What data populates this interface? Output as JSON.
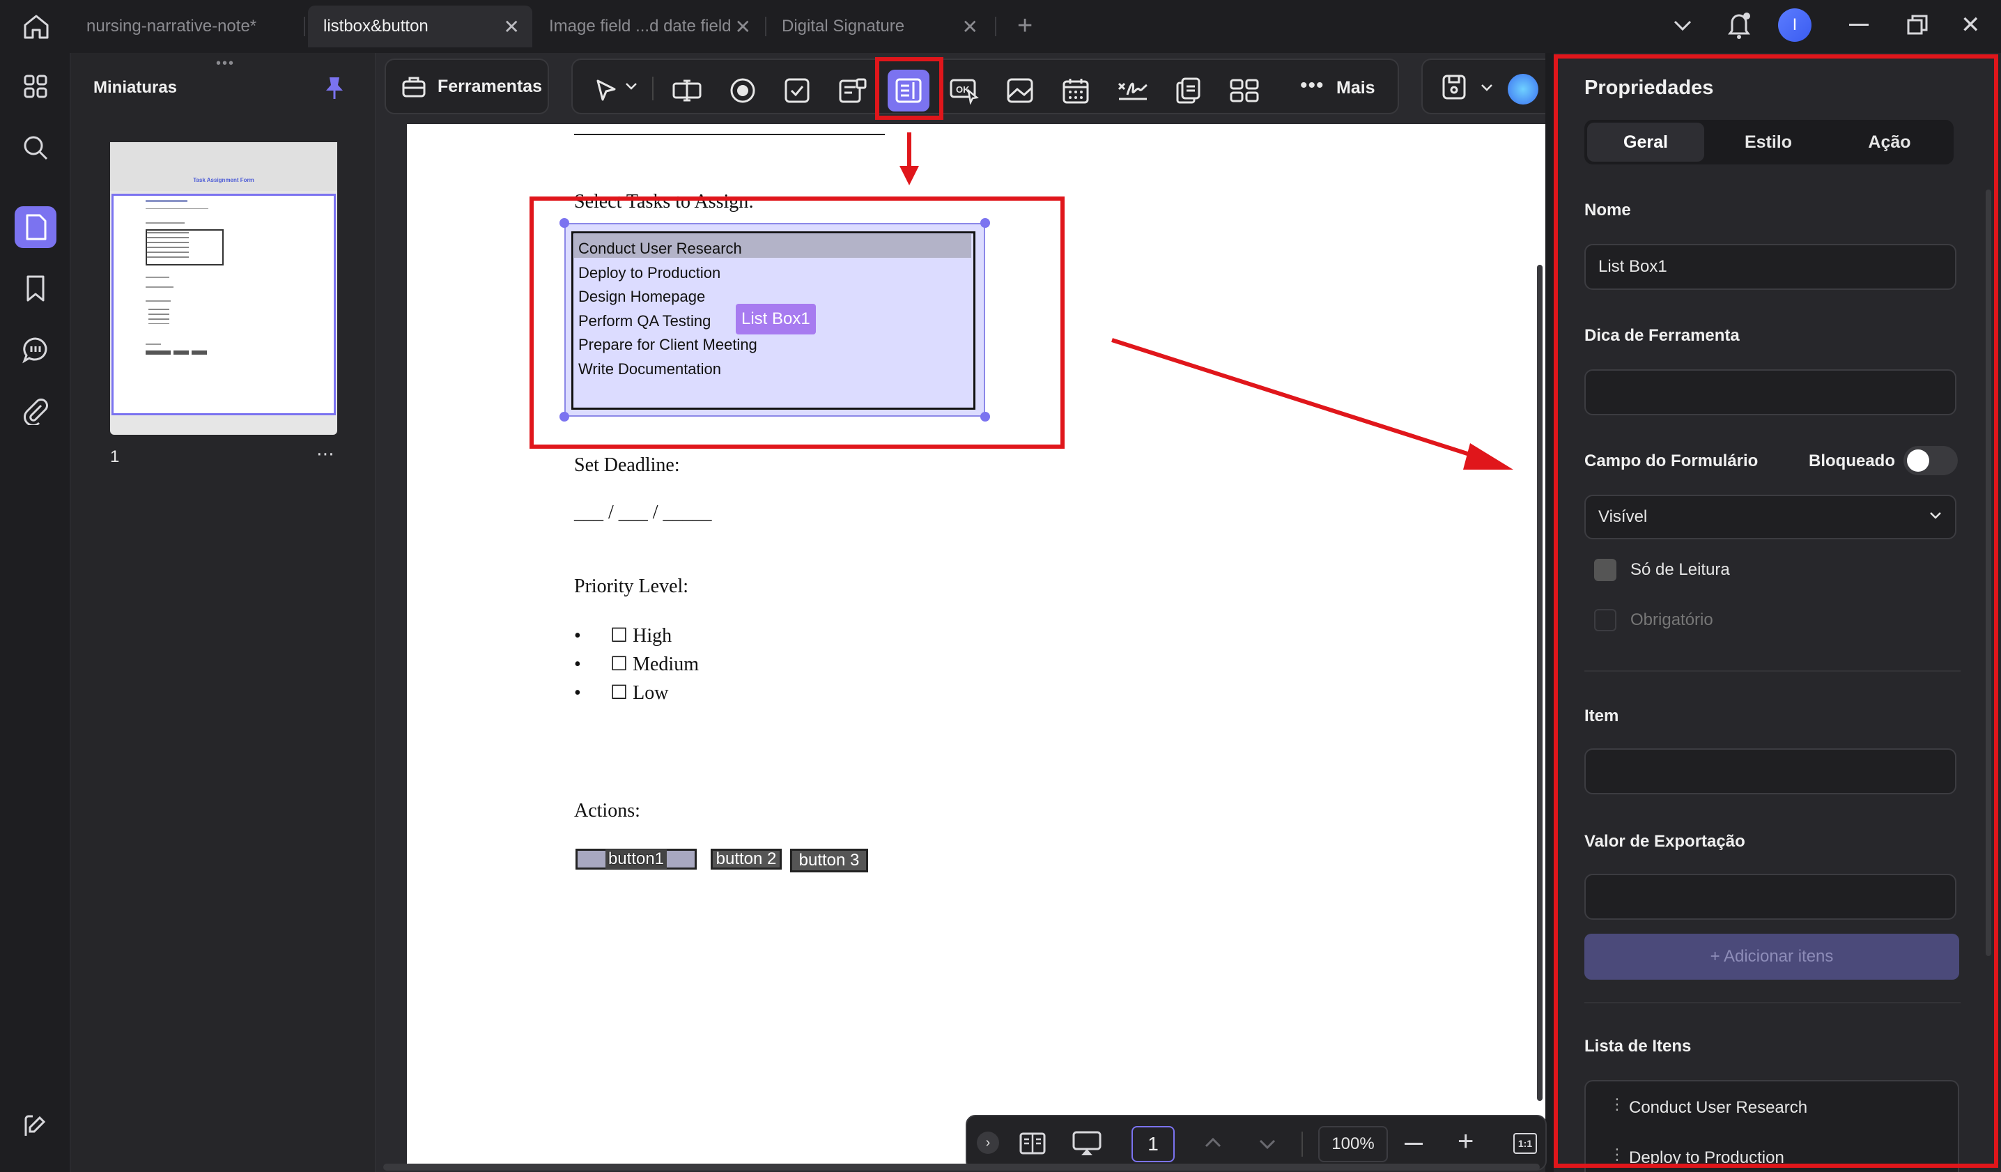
{
  "tabs": [
    {
      "label": "nursing-narrative-note*",
      "active": false
    },
    {
      "label": "listbox&button",
      "active": true
    },
    {
      "label": "Image field ...d date field",
      "active": false
    },
    {
      "label": "Digital Signature",
      "active": false
    }
  ],
  "user_avatar": "I",
  "thumbnails": {
    "title": "Miniaturas",
    "page_number": "1",
    "mini_title": "Task Assignment Form"
  },
  "toolbar": {
    "tools_label": "Ferramentas",
    "more_label": "Mais"
  },
  "document": {
    "select_tasks_label": "Select Tasks to Assign:",
    "listbox_items": [
      "Conduct User Research",
      "Deploy to Production",
      "Design Homepage",
      "Perform QA Testing",
      "Prepare for Client Meeting",
      "Write Documentation"
    ],
    "listbox_tag": "List Box1",
    "deadline_label": "Set Deadline:",
    "deadline_blank": "___ / ___ / _____",
    "priority_label": "Priority Level:",
    "priority_options": [
      "☐ High",
      "☐ Medium",
      "☐ Low"
    ],
    "actions_label": "Actions:",
    "buttons": [
      "button1",
      "button 2",
      "button 3"
    ]
  },
  "properties": {
    "title": "Propriedades",
    "tabs": [
      "Geral",
      "Estilo",
      "Ação"
    ],
    "name_label": "Nome",
    "name_value": "List Box1",
    "tooltip_label": "Dica de Ferramenta",
    "tooltip_value": "",
    "form_field_label": "Campo do Formulário",
    "locked_label": "Bloqueado",
    "visibility_value": "Visível",
    "readonly_label": "Só de Leitura",
    "required_label": "Obrigatório",
    "item_label": "Item",
    "export_label": "Valor de Exportação",
    "add_items_label": "+ Adicionar itens",
    "items_list_label": "Lista de Itens",
    "items_list": [
      "Conduct User Research",
      "Deploy to Production"
    ]
  },
  "bottom": {
    "page_input": "1",
    "zoom": "100%",
    "fit_label": "1:1"
  },
  "colors": {
    "accent": "#7b73f0",
    "annotation_red": "#e0161b",
    "listbox_fill": "#dcdcff"
  }
}
